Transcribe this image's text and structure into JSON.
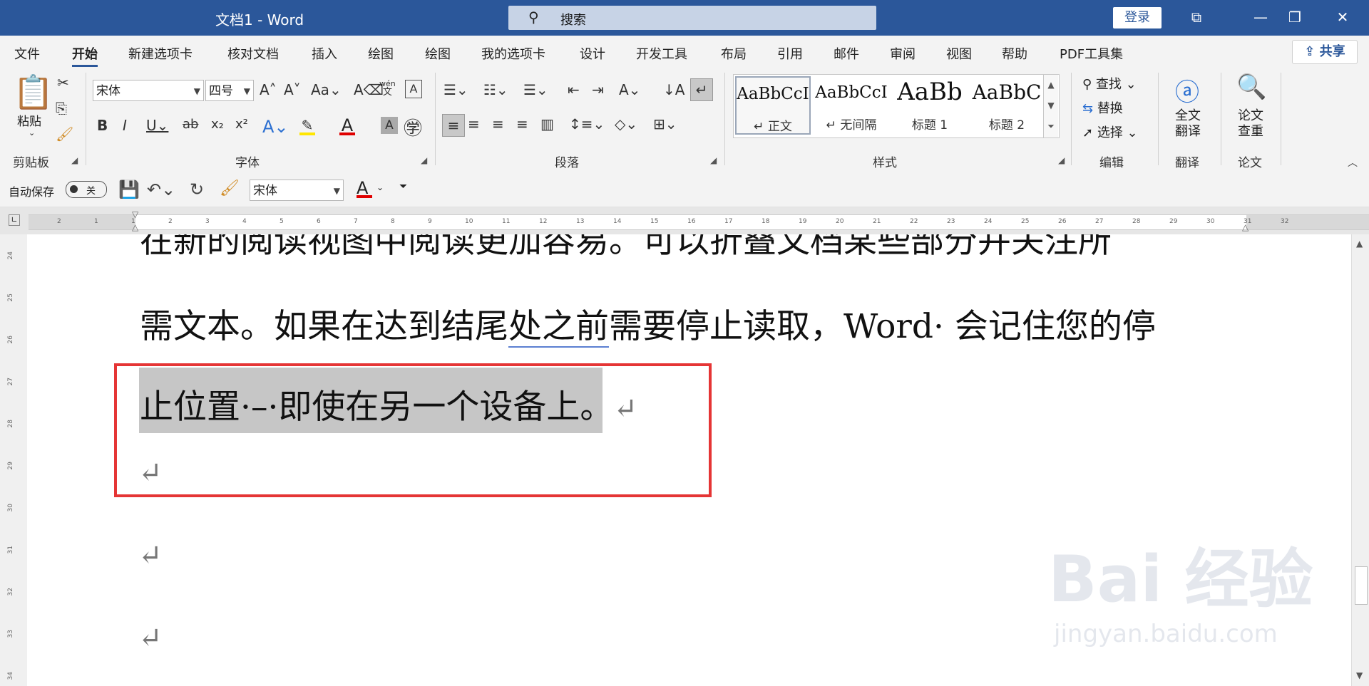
{
  "window": {
    "title": "文档1 - Word"
  },
  "search": {
    "placeholder": "搜索"
  },
  "login_label": "登录",
  "menu": {
    "tabs": [
      "文件",
      "开始",
      "新建选项卡",
      "核对文档",
      "插入",
      "绘图",
      "绘图",
      "我的选项卡",
      "设计",
      "开发工具",
      "布局",
      "引用",
      "邮件",
      "审阅",
      "视图",
      "帮助",
      "PDF工具集"
    ],
    "share_label": "共享"
  },
  "ribbon": {
    "clipboard": {
      "paste_label": "粘贴",
      "group_label": "剪贴板"
    },
    "font": {
      "font_name": "宋体",
      "font_size": "四号",
      "group_label": "字体",
      "aa_label": "Aa",
      "wen_label": "wén",
      "wen_char": "文"
    },
    "paragraph": {
      "group_label": "段落"
    },
    "styles": {
      "group_label": "样式",
      "items": [
        {
          "preview": "AaBbCcI",
          "name": "↵ 正文"
        },
        {
          "preview": "AaBbCcI",
          "name": "↵ 无间隔"
        },
        {
          "preview": "AaBb",
          "name": "标题 1"
        },
        {
          "preview": "AaBbC",
          "name": "标题 2"
        }
      ]
    },
    "editing": {
      "find": "查找",
      "replace": "替换",
      "select": "选择",
      "group_label": "编辑"
    },
    "translate": {
      "line1": "全文",
      "line2": "翻译",
      "group_label": "翻译"
    },
    "paper": {
      "line1": "论文",
      "line2": "查重",
      "group_label": "论文"
    }
  },
  "qat": {
    "autosave_label": "自动保存",
    "autosave_state": "关",
    "font_name": "宋体"
  },
  "ruler": {
    "top_ticks": [
      "2",
      "1",
      "1",
      "2",
      "3",
      "4",
      "5",
      "6",
      "7",
      "8",
      "9",
      "10",
      "11",
      "12",
      "13",
      "14",
      "15",
      "16",
      "17",
      "18",
      "19",
      "20",
      "21",
      "22",
      "23",
      "24",
      "25",
      "26",
      "27",
      "28",
      "29",
      "30",
      "31",
      "32"
    ],
    "left_ticks": [
      "24",
      "25",
      "26",
      "27",
      "28",
      "29",
      "30",
      "31",
      "32",
      "33",
      "34"
    ]
  },
  "document": {
    "line1": "在新的阅读视图中阅读更加容易。可以折叠文档某些部分并关注所",
    "line2_a": "需文本。如果在达到结尾",
    "line2_b": "处之前",
    "line2_c": "需要停止读取，Word· 会记住您的停",
    "line3": "止位置·–·即使在另一个设备上。",
    "para_mark": "↵"
  },
  "watermark": {
    "text": "Bai 经验",
    "url": "jingyan.baidu.com"
  }
}
